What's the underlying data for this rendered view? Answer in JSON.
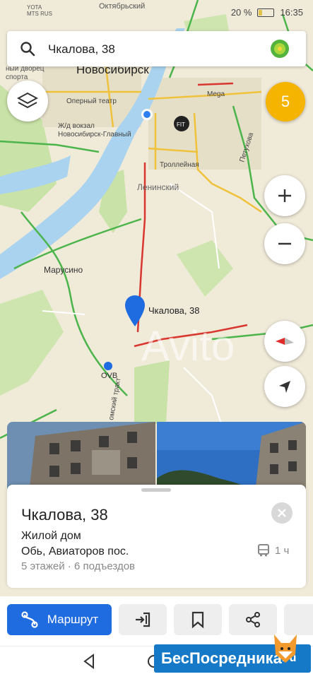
{
  "status_bar": {
    "carrier_top": "YOTA",
    "carrier_bottom": "MTS RUS",
    "battery": "20 %",
    "time": "16:35"
  },
  "search": {
    "query": "Чкалова, 38",
    "icon": "search-icon"
  },
  "map": {
    "city": "Новосибирск",
    "labels": {
      "oktyabrsky": "Октябрьский",
      "opera": "Оперный театр",
      "station1": "Ж/д вокзал",
      "station2": "Новосибирск-Главный",
      "leninsky": "Ленинский",
      "trolley": "Троллейная",
      "petukhova": "Петухова",
      "mega": "Mega",
      "marusino": "Марусино",
      "ovb": "OVB",
      "tract": "омский тракт",
      "palace": "ный дворец",
      "sports": "спорта",
      "pin_label": "Чкалова, 38",
      "fit": "FIT"
    },
    "traffic_level": "5",
    "watermark": "Avito"
  },
  "card": {
    "title": "Чкалова, 38",
    "type": "Жилой дом",
    "address": "Обь, Авиаторов пос.",
    "details": "5 этажей · 6 подъездов",
    "transit": "1 ч"
  },
  "actions": {
    "route": "Маршрут"
  },
  "watermark_corner": "БесПосредника",
  "watermark_corner_suffix": ".ru",
  "colors": {
    "accent": "#1f6be0",
    "traffic_badge": "#f5b400",
    "water": "#a9d3ee",
    "park": "#c9e2a7"
  }
}
